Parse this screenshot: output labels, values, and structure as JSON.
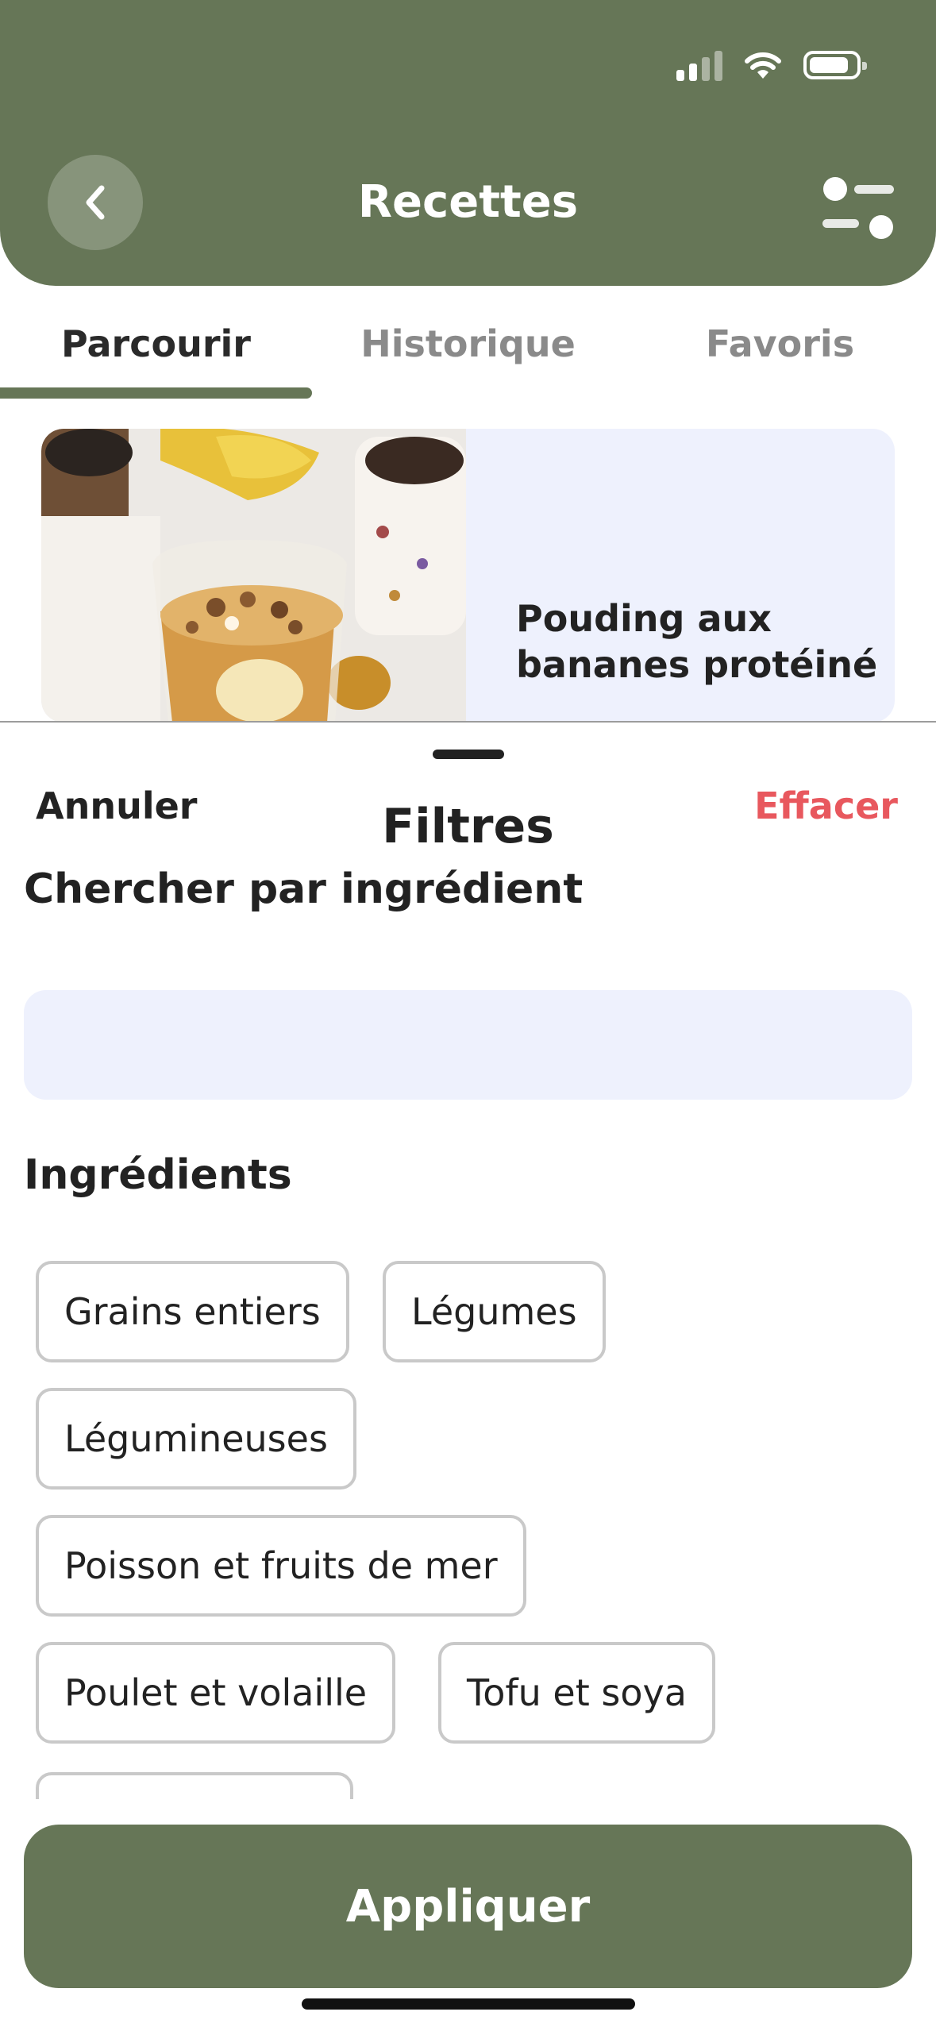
{
  "header": {
    "title": "Recettes",
    "accent_color": "#667657",
    "back_icon": "chevron-left-icon",
    "filter_icon": "sliders-icon"
  },
  "status_bar": {
    "signal_icon": "signal-icon",
    "wifi_icon": "wifi-icon",
    "battery_icon": "battery-icon"
  },
  "tabs": [
    {
      "label": "Parcourir",
      "active": true
    },
    {
      "label": "Historique",
      "active": false
    },
    {
      "label": "Favoris",
      "active": false
    }
  ],
  "recipe_card": {
    "title": "Pouding aux bananes protéiné",
    "image": "banana-pudding-photo"
  },
  "sheet": {
    "cancel_label": "Annuler",
    "title": "Filtres",
    "clear_label": "Effacer",
    "clear_color": "#e8585e",
    "search_section": "Chercher par ingrédient",
    "search_value": "",
    "ingredients_section": "Ingrédients",
    "chips": [
      "Grains entiers",
      "Légumes",
      "Légumineuses",
      "Poisson et fruits de mer",
      "Poulet et volaille",
      "Tofu et soya",
      ""
    ],
    "apply_label": "Appliquer"
  }
}
